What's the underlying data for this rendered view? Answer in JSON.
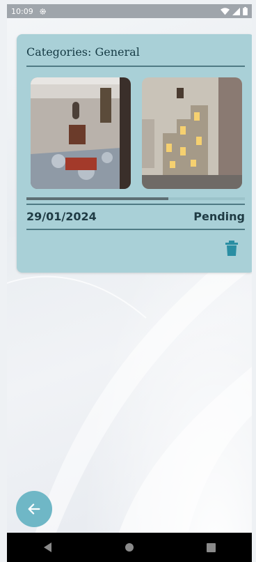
{
  "status_bar": {
    "time": "10:09",
    "icons": [
      "settings-icon",
      "wifi-icon",
      "signal-icon",
      "battery-icon"
    ]
  },
  "card": {
    "title": "Categories: General",
    "photos": [
      "room-photo",
      "shelf-photo"
    ],
    "progress": 0.65,
    "date": "29/01/2024",
    "status": "Pending",
    "delete_icon": "trash-icon"
  },
  "fab": {
    "icon": "arrow-left-icon"
  },
  "nav": {
    "buttons": [
      "back-icon",
      "home-icon",
      "recents-icon"
    ]
  },
  "colors": {
    "card": "#a9d0d7",
    "accent": "#2a8ea3",
    "fab": "#6fb7c6"
  }
}
